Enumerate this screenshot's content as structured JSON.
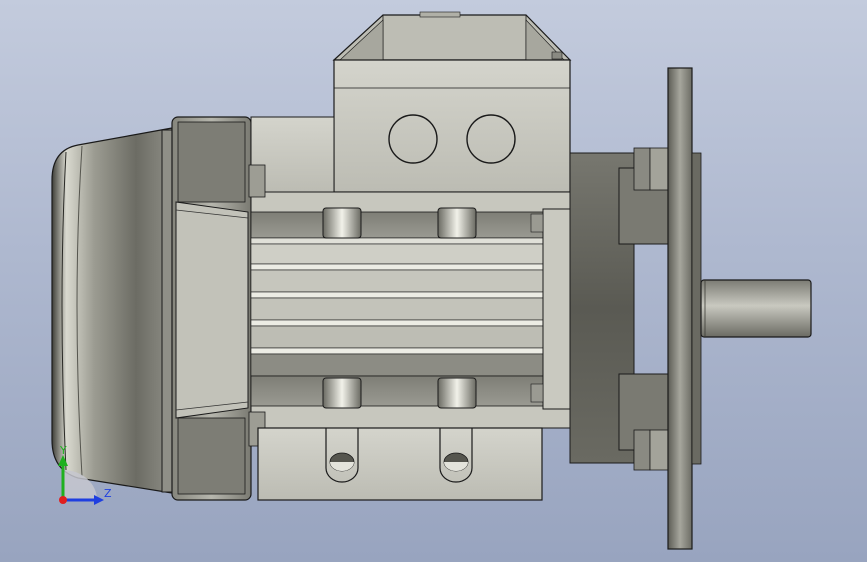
{
  "viewport": {
    "background_top": "#c3cbdd",
    "background_bottom": "#98a4bf"
  },
  "triad": {
    "y_label": "Y",
    "z_label": "Z",
    "y_color": "#1fb01f",
    "z_color": "#1f3fe0",
    "x_color": "#e01f1f"
  },
  "model": {
    "object": "electric-motor-with-flange",
    "colors": {
      "body": "#c8c8c0",
      "dark_steel": "#6e6e66",
      "outline": "#1a1a1a"
    }
  }
}
